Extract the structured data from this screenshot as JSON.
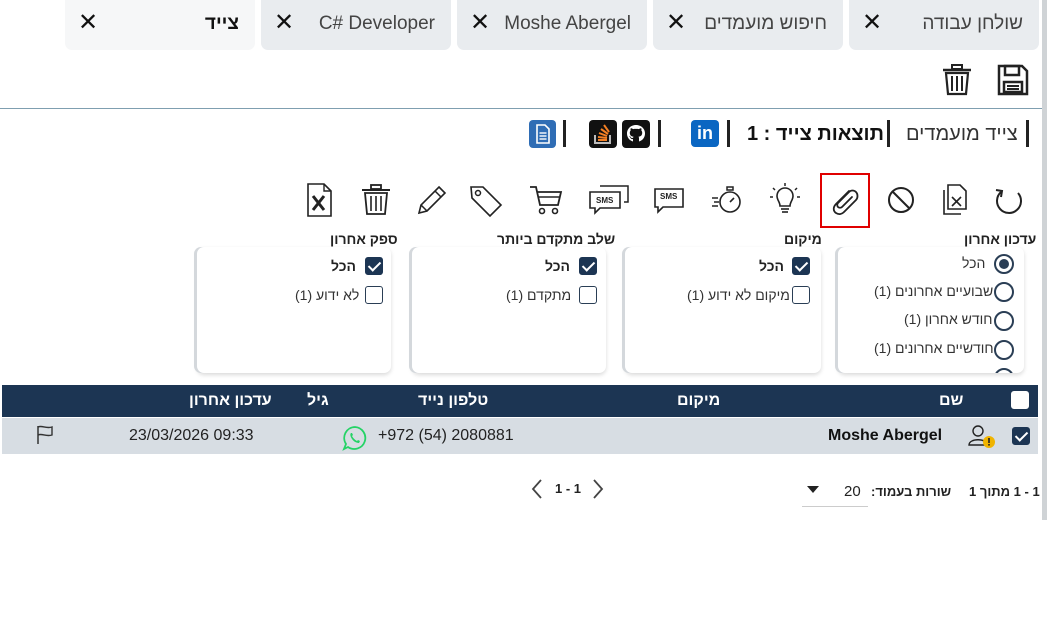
{
  "tabs": [
    {
      "label": "שולחן עבודה",
      "active": false
    },
    {
      "label": "חיפוש מועמדים",
      "active": false
    },
    {
      "label": "Moshe Abergel",
      "active": false
    },
    {
      "label": "C# Developer",
      "active": false
    },
    {
      "label": "צייד",
      "active": true
    }
  ],
  "header": {
    "page_title": "צייד מועמדים",
    "results_label": "תוצאות צייד : 1",
    "linkedin_text": "in"
  },
  "toolbar": {
    "items": [
      "refresh-icon",
      "close-document-icon",
      "block-icon",
      "paperclip-icon",
      "lightbulb-icon",
      "stopwatch-icon",
      "sms-icon",
      "sms-multiple-icon",
      "cart-icon",
      "tag-icon",
      "pencil-icon",
      "trash-icon",
      "excel-icon"
    ],
    "highlighted": "paperclip-icon",
    "sms_label": "SMS"
  },
  "filters": {
    "last_update": {
      "title": "עדכון אחרון",
      "options": [
        {
          "label": "הכל",
          "selected": true
        },
        {
          "label": "שבועיים אחרונים (1)",
          "selected": false
        },
        {
          "label": "חודש אחרון (1)",
          "selected": false
        },
        {
          "label": "חודשיים אחרונים (1)",
          "selected": false
        }
      ]
    },
    "location": {
      "title": "מיקום",
      "options": [
        {
          "label": "הכל",
          "checked": true
        },
        {
          "label": "מיקום לא ידוע (1)",
          "checked": false
        }
      ]
    },
    "most_advanced_stage": {
      "title": "שלב מתקדם ביותר",
      "options": [
        {
          "label": "הכל",
          "checked": true
        },
        {
          "label": "מתקדם (1)",
          "checked": false
        }
      ]
    },
    "last_supplier": {
      "title": "ספק אחרון",
      "options": [
        {
          "label": "הכל",
          "checked": true
        },
        {
          "label": "לא ידוע (1)",
          "checked": false
        }
      ]
    }
  },
  "table": {
    "columns": [
      "שם",
      "מיקום",
      "טלפון נייד",
      "גיל",
      "עדכון אחרון"
    ],
    "rows": [
      {
        "name": "Moshe Abergel",
        "location": "",
        "phone": "+972 (54) 2080881",
        "age": "",
        "last_update": "23/03/2026 09:33",
        "checked": true
      }
    ]
  },
  "pagination": {
    "range_label": "1 - 1 מתוך 1",
    "rows_per_page_label": "שורות בעמוד:",
    "rows_per_page_value": "20",
    "page_label": "1 - 1"
  },
  "colors": {
    "navy": "#1c3553",
    "highlight": "#e00000",
    "whatsapp": "#25d366",
    "linkedin": "#0a66c2"
  }
}
